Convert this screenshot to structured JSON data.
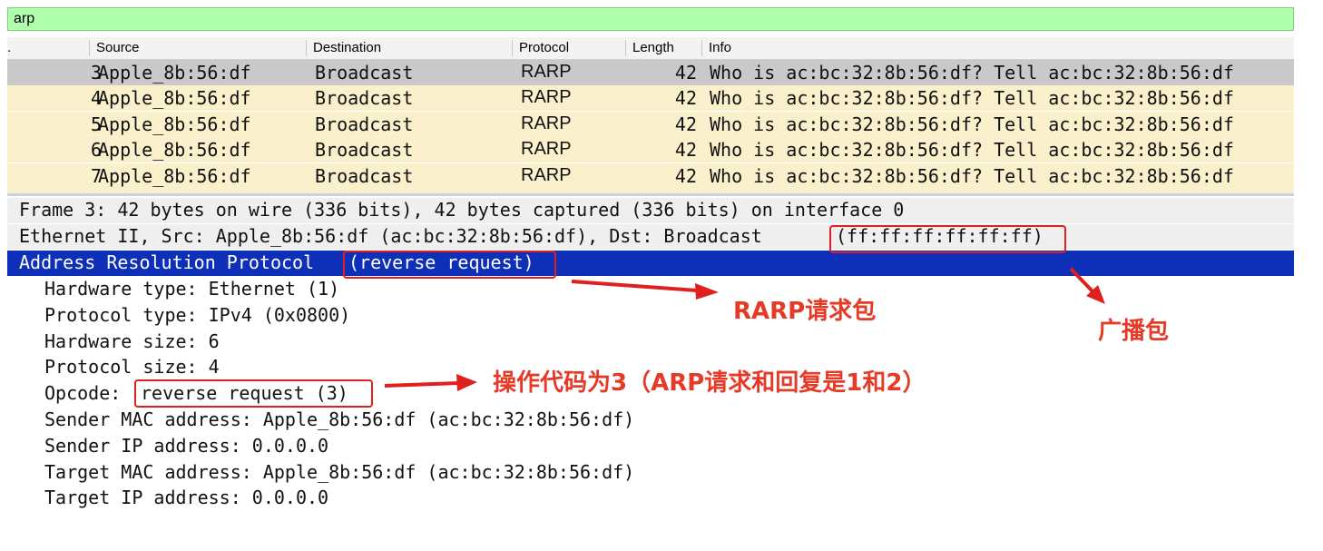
{
  "filter": {
    "value": "arp"
  },
  "columns": [
    "Source",
    "Destination",
    "Protocol",
    "Length",
    "Info"
  ],
  "column_fragment": ".",
  "packets": [
    {
      "no": "3",
      "source": "Apple_8b:56:df",
      "destination": "Broadcast",
      "protocol": "RARP",
      "length": "42",
      "info": "Who is ac:bc:32:8b:56:df? Tell ac:bc:32:8b:56:df",
      "selected": true
    },
    {
      "no": "4",
      "source": "Apple_8b:56:df",
      "destination": "Broadcast",
      "protocol": "RARP",
      "length": "42",
      "info": "Who is ac:bc:32:8b:56:df? Tell ac:bc:32:8b:56:df"
    },
    {
      "no": "5",
      "source": "Apple_8b:56:df",
      "destination": "Broadcast",
      "protocol": "RARP",
      "length": "42",
      "info": "Who is ac:bc:32:8b:56:df? Tell ac:bc:32:8b:56:df"
    },
    {
      "no": "6",
      "source": "Apple_8b:56:df",
      "destination": "Broadcast",
      "protocol": "RARP",
      "length": "42",
      "info": "Who is ac:bc:32:8b:56:df? Tell ac:bc:32:8b:56:df"
    },
    {
      "no": "7",
      "source": "Apple_8b:56:df",
      "destination": "Broadcast",
      "protocol": "RARP",
      "length": "42",
      "info": "Who is ac:bc:32:8b:56:df? Tell ac:bc:32:8b:56:df"
    }
  ],
  "details": {
    "frame": "Frame 3: 42 bytes on wire (336 bits), 42 bytes captured (336 bits) on interface 0",
    "ethernet_prefix": "Ethernet II, Src: Apple_8b:56:df (ac:bc:32:8b:56:df), Dst: Broadcast ",
    "ethernet_dst_mac": "(ff:ff:ff:ff:ff:ff)",
    "arp_prefix": "Address Resolution Protocol ",
    "arp_type": "(reverse request)",
    "fields": [
      "Hardware type: Ethernet (1)",
      "Protocol type: IPv4 (0x0800)",
      "Hardware size: 6",
      "Protocol size: 4"
    ],
    "opcode_prefix": "Opcode: ",
    "opcode_value": "reverse request (3)",
    "fields_after": [
      "Sender MAC address: Apple_8b:56:df (ac:bc:32:8b:56:df)",
      "Sender IP address: 0.0.0.0",
      "Target MAC address: Apple_8b:56:df (ac:bc:32:8b:56:df)",
      "Target IP address: 0.0.0.0"
    ]
  },
  "annotations": {
    "rarp_request": "RARP请求包",
    "broadcast": "广播包",
    "opcode_note": "操作代码为3（ARP请求和回复是1和2）"
  },
  "colors": {
    "filter_bg": "#afffaf",
    "selected_row": "#c9c9c9",
    "row_bg": "#fbf0cc",
    "highlight": "#0e2fb8",
    "annotation_red": "#e53a27"
  }
}
